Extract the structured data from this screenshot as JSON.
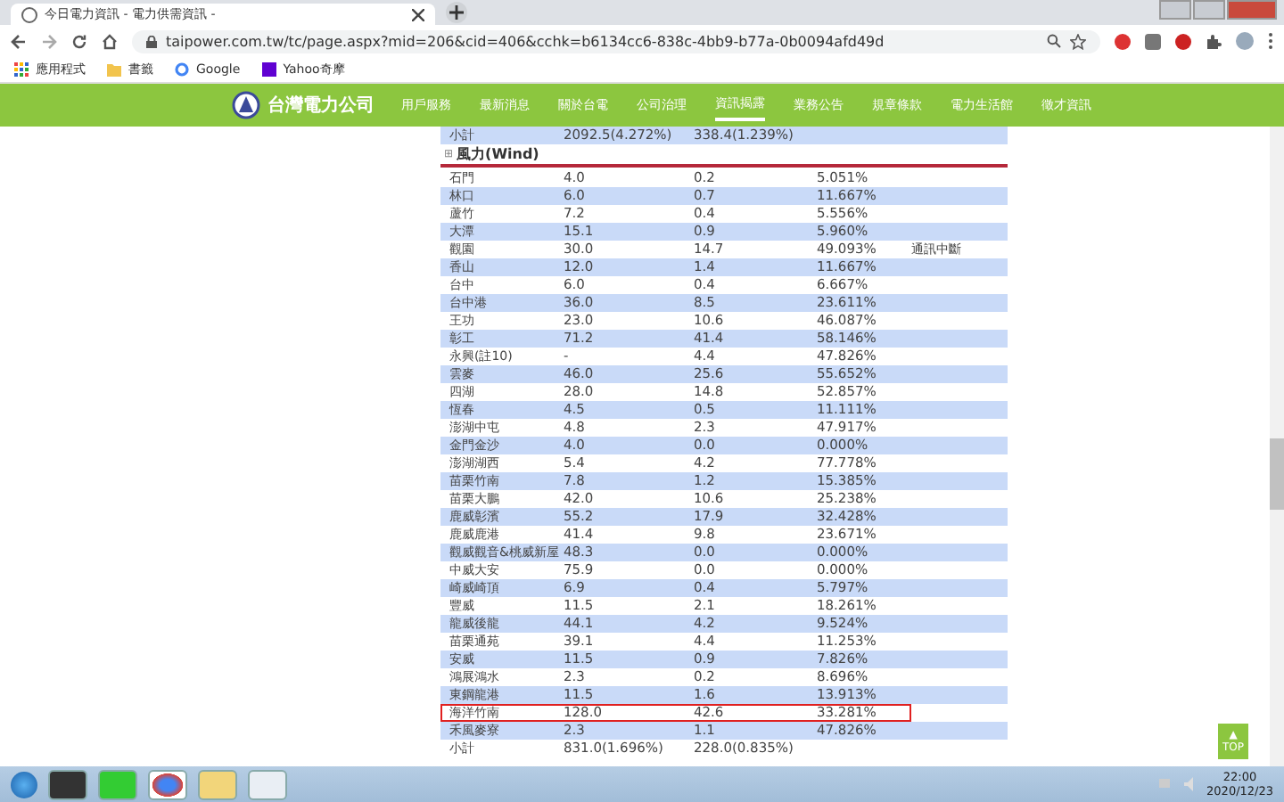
{
  "browser": {
    "tab_title": "今日電力資訊 - 電力供需資訊 -",
    "url": "taipower.com.tw/tc/page.aspx?mid=206&cid=406&cchk=b6134cc6-838c-4bb9-b77a-0b0094afd49d",
    "bookmarks": [
      "應用程式",
      "書籤",
      "Google",
      "Yahoo奇摩"
    ]
  },
  "site": {
    "logo": "台灣電力公司",
    "nav": [
      {
        "label": "用戶服務",
        "selected": false
      },
      {
        "label": "最新消息",
        "selected": false
      },
      {
        "label": "關於台電",
        "selected": false
      },
      {
        "label": "公司治理",
        "selected": false
      },
      {
        "label": "資訊揭露",
        "selected": true
      },
      {
        "label": "業務公告",
        "selected": false
      },
      {
        "label": "規章條款",
        "selected": false
      },
      {
        "label": "電力生活館",
        "selected": false
      },
      {
        "label": "徵才資訊",
        "selected": false
      }
    ]
  },
  "prev_subtotal": {
    "label": "小計",
    "capacity": "2092.5(4.272%)",
    "output": "338.4(1.239%)"
  },
  "section": {
    "expander": "⊞",
    "title": "風力(Wind)"
  },
  "rows": [
    {
      "name": "石門",
      "capacity": "4.0",
      "output": "0.2",
      "ratio": "5.051%",
      "note": "",
      "highlighted": false
    },
    {
      "name": "林口",
      "capacity": "6.0",
      "output": "0.7",
      "ratio": "11.667%",
      "note": "",
      "highlighted": false
    },
    {
      "name": "蘆竹",
      "capacity": "7.2",
      "output": "0.4",
      "ratio": "5.556%",
      "note": "",
      "highlighted": false
    },
    {
      "name": "大潭",
      "capacity": "15.1",
      "output": "0.9",
      "ratio": "5.960%",
      "note": "",
      "highlighted": false
    },
    {
      "name": "觀園",
      "capacity": "30.0",
      "output": "14.7",
      "ratio": "49.093%",
      "note": "通訊中斷",
      "highlighted": false
    },
    {
      "name": "香山",
      "capacity": "12.0",
      "output": "1.4",
      "ratio": "11.667%",
      "note": "",
      "highlighted": false
    },
    {
      "name": "台中",
      "capacity": "6.0",
      "output": "0.4",
      "ratio": "6.667%",
      "note": "",
      "highlighted": false
    },
    {
      "name": "台中港",
      "capacity": "36.0",
      "output": "8.5",
      "ratio": "23.611%",
      "note": "",
      "highlighted": false
    },
    {
      "name": "王功",
      "capacity": "23.0",
      "output": "10.6",
      "ratio": "46.087%",
      "note": "",
      "highlighted": false
    },
    {
      "name": "彰工",
      "capacity": "71.2",
      "output": "41.4",
      "ratio": "58.146%",
      "note": "",
      "highlighted": false
    },
    {
      "name": "永興(註10)",
      "capacity": "-",
      "output": "4.4",
      "ratio": "47.826%",
      "note": "",
      "highlighted": false
    },
    {
      "name": "雲麥",
      "capacity": "46.0",
      "output": "25.6",
      "ratio": "55.652%",
      "note": "",
      "highlighted": false
    },
    {
      "name": "四湖",
      "capacity": "28.0",
      "output": "14.8",
      "ratio": "52.857%",
      "note": "",
      "highlighted": false
    },
    {
      "name": "恆春",
      "capacity": "4.5",
      "output": "0.5",
      "ratio": "11.111%",
      "note": "",
      "highlighted": false
    },
    {
      "name": "澎湖中屯",
      "capacity": "4.8",
      "output": "2.3",
      "ratio": "47.917%",
      "note": "",
      "highlighted": false
    },
    {
      "name": "金門金沙",
      "capacity": "4.0",
      "output": "0.0",
      "ratio": "0.000%",
      "note": "",
      "highlighted": false
    },
    {
      "name": "澎湖湖西",
      "capacity": "5.4",
      "output": "4.2",
      "ratio": "77.778%",
      "note": "",
      "highlighted": false
    },
    {
      "name": "苗栗竹南",
      "capacity": "7.8",
      "output": "1.2",
      "ratio": "15.385%",
      "note": "",
      "highlighted": false
    },
    {
      "name": "苗栗大鵬",
      "capacity": "42.0",
      "output": "10.6",
      "ratio": "25.238%",
      "note": "",
      "highlighted": false
    },
    {
      "name": "鹿威彰濱",
      "capacity": "55.2",
      "output": "17.9",
      "ratio": "32.428%",
      "note": "",
      "highlighted": false
    },
    {
      "name": "鹿威鹿港",
      "capacity": "41.4",
      "output": "9.8",
      "ratio": "23.671%",
      "note": "",
      "highlighted": false
    },
    {
      "name": "觀威觀音&桃威新屋",
      "capacity": "48.3",
      "output": "0.0",
      "ratio": "0.000%",
      "note": "",
      "highlighted": false
    },
    {
      "name": "中威大安",
      "capacity": "75.9",
      "output": "0.0",
      "ratio": "0.000%",
      "note": "",
      "highlighted": false
    },
    {
      "name": "崎威崎頂",
      "capacity": "6.9",
      "output": "0.4",
      "ratio": "5.797%",
      "note": "",
      "highlighted": false
    },
    {
      "name": "豐威",
      "capacity": "11.5",
      "output": "2.1",
      "ratio": "18.261%",
      "note": "",
      "highlighted": false
    },
    {
      "name": "龍威後龍",
      "capacity": "44.1",
      "output": "4.2",
      "ratio": "9.524%",
      "note": "",
      "highlighted": false
    },
    {
      "name": "苗栗通苑",
      "capacity": "39.1",
      "output": "4.4",
      "ratio": "11.253%",
      "note": "",
      "highlighted": false
    },
    {
      "name": "安威",
      "capacity": "11.5",
      "output": "0.9",
      "ratio": "7.826%",
      "note": "",
      "highlighted": false
    },
    {
      "name": "鴻展鴻水",
      "capacity": "2.3",
      "output": "0.2",
      "ratio": "8.696%",
      "note": "",
      "highlighted": false
    },
    {
      "name": "東鋼龍港",
      "capacity": "11.5",
      "output": "1.6",
      "ratio": "13.913%",
      "note": "",
      "highlighted": false
    },
    {
      "name": "海洋竹南",
      "capacity": "128.0",
      "output": "42.6",
      "ratio": "33.281%",
      "note": "",
      "highlighted": true
    },
    {
      "name": "禾風麥寮",
      "capacity": "2.3",
      "output": "1.1",
      "ratio": "47.826%",
      "note": "",
      "highlighted": false
    }
  ],
  "subtotal": {
    "label": "小計",
    "capacity": "831.0(1.696%)",
    "output": "228.0(0.835%)"
  },
  "scroll_top": {
    "line1": "▲",
    "line2": "TOP"
  },
  "taskbar": {
    "time": "22:00",
    "date": "2020/12/23"
  }
}
